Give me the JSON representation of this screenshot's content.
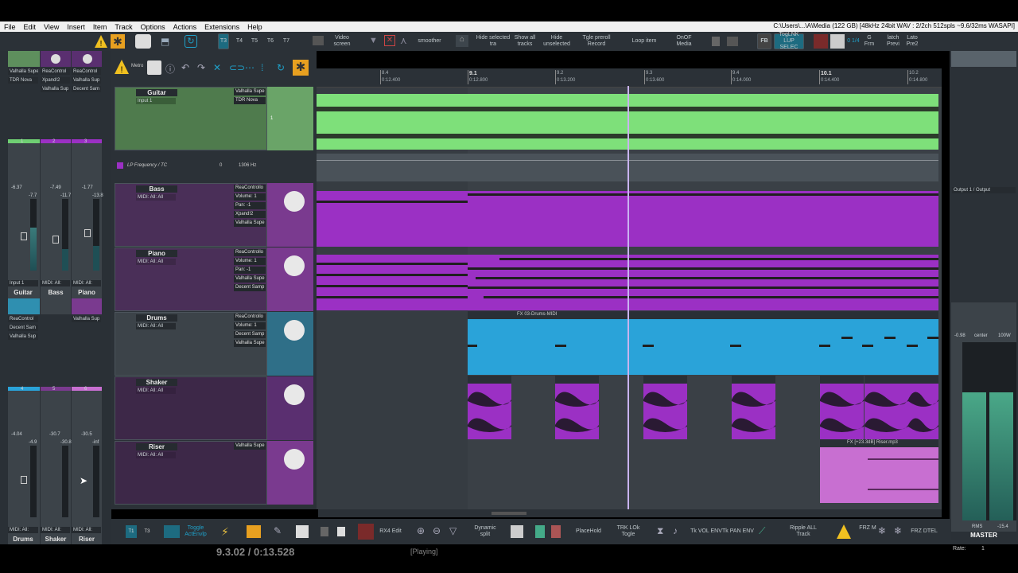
{
  "menubar": {
    "items": [
      "File",
      "Edit",
      "View",
      "Insert",
      "Item",
      "Track",
      "Options",
      "Actions",
      "Extensions",
      "Help"
    ],
    "status": "C:\\Users\\...\\A\\Media (122 GB) [48kHz 24bit WAV : 2/2ch 512spls ~9.6/32ms WASAPI]"
  },
  "toolbar": {
    "tabs": [
      "T3",
      "T4",
      "T5",
      "T6",
      "T7"
    ],
    "video_screen": "Video screen",
    "smoother": "smoother",
    "hide_selected": "Hide selected tra",
    "show_all": "Show all tracks",
    "hide_unselected": "Hide unselected",
    "tgle_preroll": "Tgle preroll Record",
    "loop_item": "Loop item",
    "onoff_media": "OnOF Media",
    "fb": "FB",
    "toglnk": "TogLNK LUP SELEC",
    "counter": "0 1/4",
    "g_frm": "G Frm",
    "latch_previ": "latch Previ",
    "lato_pre2": "Lato Pre2"
  },
  "secondbar": {
    "metro": "Metro"
  },
  "ruler": {
    "labels": [
      {
        "top": "9.1",
        "bottom": "0:12.800",
        "main": true
      },
      {
        "top": "9.2",
        "bottom": "0:13.200",
        "main": false
      },
      {
        "top": "9.3",
        "bottom": "0:13.600",
        "main": false
      },
      {
        "top": "9.4",
        "bottom": "0:14.000",
        "main": false
      },
      {
        "top": "10.1",
        "bottom": "0:14.400",
        "main": true
      },
      {
        "top": "10.2",
        "bottom": "0:14.800",
        "main": false
      },
      {
        "top": "8.4",
        "bottom": "0:12.400",
        "main": false
      }
    ]
  },
  "tracks": [
    {
      "name": "Guitar",
      "input": "Input 1",
      "fx": [
        "Valhalla Supe",
        "TDR Nova"
      ],
      "num": "1",
      "color": "#6fcf73"
    },
    {
      "name": "Bass",
      "input": "MIDI: All: All",
      "fx": [
        "ReaControllo",
        "Volume: 1",
        "Pan: -1",
        "Xpand!2",
        "Valhalla Supe"
      ],
      "num": "2",
      "color": "#7a3a8f"
    },
    {
      "name": "Piano",
      "input": "MIDI: All: All",
      "fx": [
        "ReaControllo",
        "Volume: 1",
        "Pan: -1",
        "Valhalla Supe",
        "Decent Samp"
      ],
      "num": "3",
      "color": "#7a3a8f"
    },
    {
      "name": "Drums",
      "input": "MIDI: All: All",
      "fx": [
        "ReaControllo",
        "Volume: 1",
        "Decent Samp",
        "Valhalla Supe"
      ],
      "num": "4",
      "color": "#2f8fb0"
    },
    {
      "name": "Shaker",
      "input": "MIDI: All: All",
      "fx": [],
      "num": "5",
      "color": "#5a2f70"
    },
    {
      "name": "Riser",
      "input": "MIDI: All: All",
      "fx": [
        "Valhalla Supe"
      ],
      "num": "6",
      "color": "#7a3a8f"
    }
  ],
  "envelope": {
    "label": "LP Frequency / TC",
    "value": "0",
    "hz": "1306 Hz"
  },
  "items": {
    "drums_item": "FX 03-Drums-MIDI",
    "riser_item": "FX [+23.3dB] Riser.mp3"
  },
  "mixer": {
    "top_fx": [
      [
        "Valhalla Supe",
        "TDR Nova"
      ],
      [
        "ReaControl",
        "Xpand!2",
        "Valhalla Sup"
      ],
      [
        "ReaControl",
        "Valhalla Sup",
        "Decent Sam"
      ]
    ],
    "group1": [
      {
        "name": "Guitar",
        "db": "-6.37",
        "peak": "-7.7",
        "in": "Input 1"
      },
      {
        "name": "Bass",
        "db": "-7.49",
        "peak": "-11.7",
        "in": "MIDI: All:"
      },
      {
        "name": "Piano",
        "db": "-1.77",
        "peak": "-13.8",
        "in": "MIDI: All:"
      }
    ],
    "mid_fx": [
      [
        "ReaControl",
        "Decent Sam",
        "Valhalla Sup"
      ],
      [],
      [
        "Valhalla Sup"
      ]
    ],
    "group2": [
      {
        "name": "Drums",
        "db": "-4.04",
        "peak": "-4.9",
        "in": "MIDI: All:"
      },
      {
        "name": "Shaker",
        "db": "-30.7",
        "peak": "-30.8",
        "in": "MIDI: All:"
      },
      {
        "name": "Riser",
        "db": "-30.5",
        "peak": "-inf",
        "in": "MIDI: All:"
      }
    ],
    "nums1": [
      "1",
      "2",
      "3"
    ],
    "nums2": [
      "4",
      "5",
      "6"
    ]
  },
  "master": {
    "label": "MASTER",
    "output": "Output 1 / Output",
    "db_left": "-0.98",
    "center": "center",
    "width": "100W",
    "rms": "RMS",
    "rms_val": "-15.4",
    "rate_label": "Rate:",
    "rate": "1"
  },
  "bottombar": {
    "rx4": "RX4 Edit",
    "dynamic_split": "Dynamic split",
    "placehold": "PlaceHold",
    "trk_lok": "TRK LOk Togle",
    "tk_vol": "Tk VOL ENV",
    "tk_pan": "Tk PAN ENV",
    "ripple": "Ripple ALL Track",
    "frz": "FRZ M",
    "frz_dtel": "FRZ DTEL",
    "toggle_actenvlp": "Toggle ActEnvlp",
    "tab1": "T1",
    "tab2": "T3"
  },
  "transport": {
    "time": "9.3.02 / 0:13.528",
    "state": "[Playing]"
  },
  "colors": {
    "guitar": "#7ee07a",
    "midi_purple": "#9b30c4",
    "drums_blue": "#2aa3d9",
    "riser_pink": "#c86fd1",
    "playhead": "#c9b3f0"
  }
}
